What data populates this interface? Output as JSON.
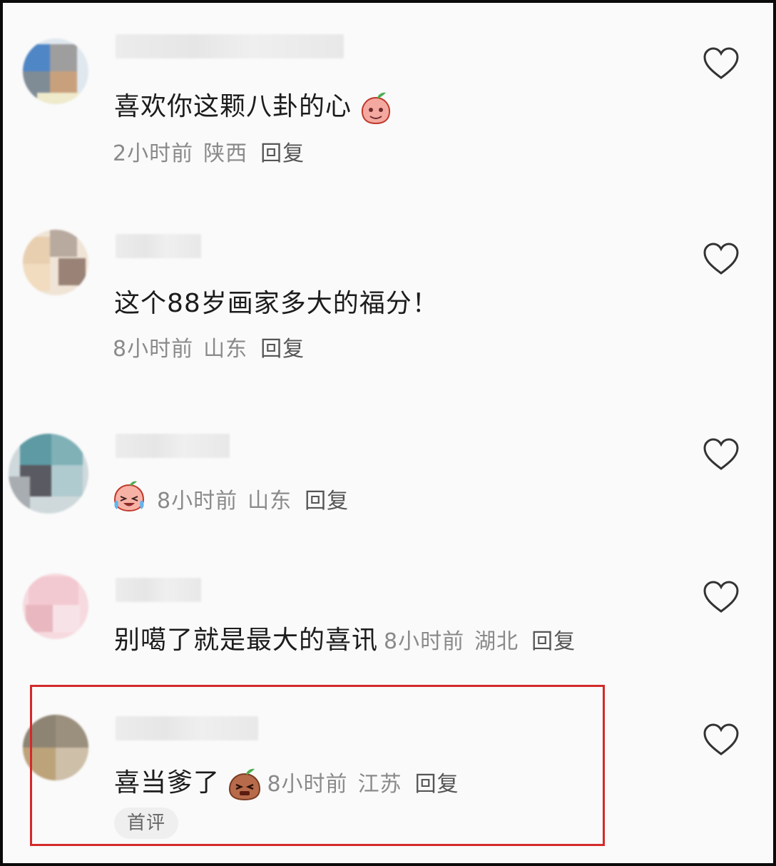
{
  "comments": [
    {
      "text": "喜欢你这颗八卦的心",
      "time": "2小时前",
      "location": "陕西",
      "reply": "回复",
      "emoji": "pink-peach-face-emoji"
    },
    {
      "text": "这个88岁画家多大的福分！",
      "time": "8小时前",
      "location": "山东",
      "reply": "回复"
    },
    {
      "text": "",
      "time": "8小时前",
      "location": "山东",
      "reply": "回复",
      "emoji": "crying-laughing-peach-emoji"
    },
    {
      "text": "别噶了就是最大的喜讯",
      "time": "8小时前",
      "location": "湖北",
      "reply": "回复"
    },
    {
      "text": "喜当爹了",
      "time": "8小时前",
      "location": "江苏",
      "reply": "回复",
      "emoji": "brown-grimace-peach-emoji",
      "badge": "首评",
      "highlighted": true
    }
  ],
  "icons": {
    "like": "heart-outline-icon"
  },
  "colors": {
    "highlight": "#d42a2a",
    "meta": "#8a8a8a",
    "text": "#1c1c1c"
  }
}
